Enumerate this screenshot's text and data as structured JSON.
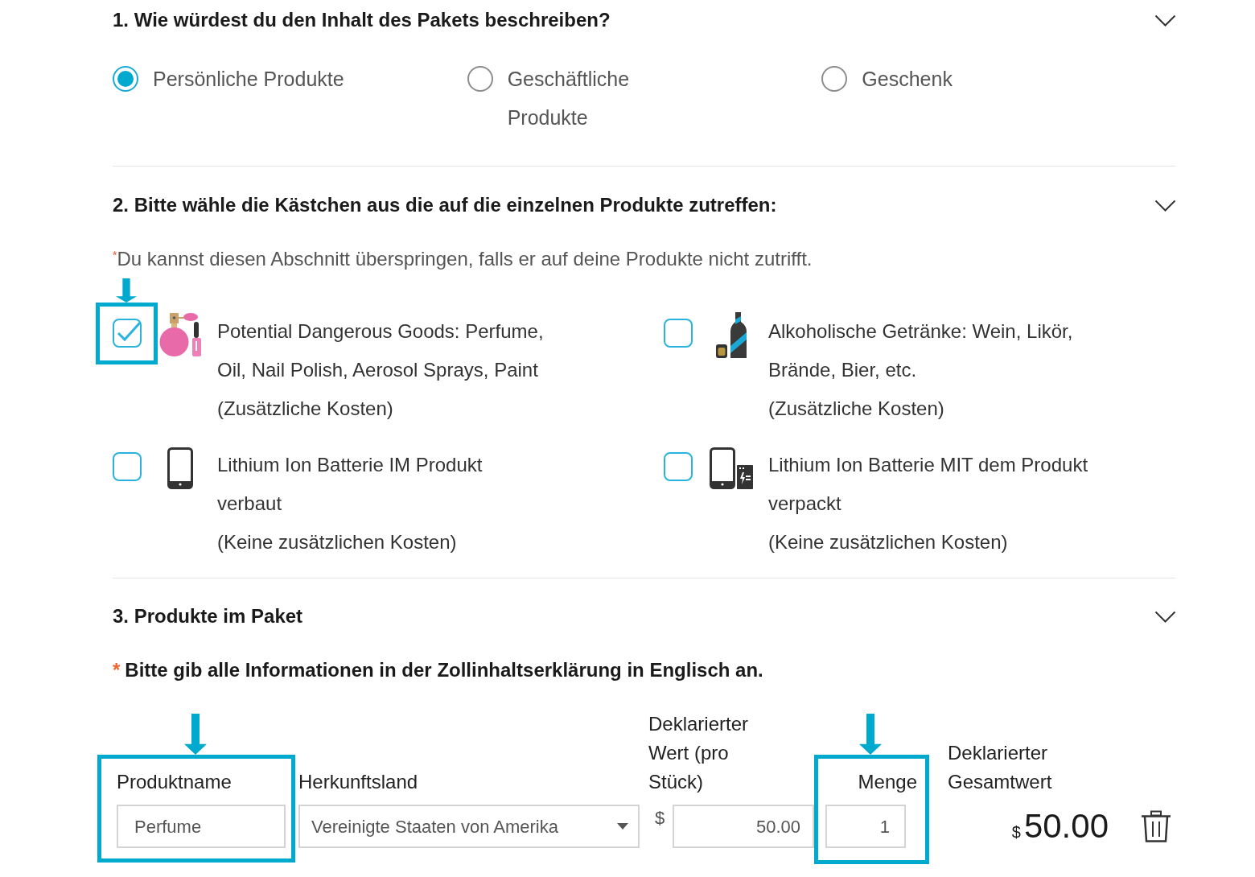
{
  "content_type": {
    "title": "1. Wie würdest du den Inhalt des Pakets beschreiben?",
    "options": [
      {
        "label": "Persönliche Produkte",
        "selected": true
      },
      {
        "label": "Geschäftliche Produkte",
        "selected": false
      },
      {
        "label": "Geschenk",
        "selected": false
      }
    ]
  },
  "product_flags": {
    "title": "2. Bitte wähle die Kästchen aus die auf die einzelnen Produkte zutreffen:",
    "note_mark": "*",
    "note": "Du kannst diesen Abschnitt überspringen, falls er auf deine Produkte nicht zutrifft.",
    "items": [
      {
        "kind": "perfume",
        "label": "Potential Dangerous Goods: Perfume, Oil, Nail Polish, Aerosol Sprays, Paint",
        "cost": "(Zusätzliche Kosten)",
        "checked": true,
        "highlighted": true
      },
      {
        "kind": "alcohol",
        "label": "Alkoholische Getränke: Wein, Likör, Brände, Bier, etc.",
        "cost": "(Zusätzliche Kosten)",
        "checked": false,
        "highlighted": false
      },
      {
        "kind": "battery_in",
        "label": "Lithium Ion Batterie IM Produkt verbaut",
        "cost": "(Keine zusätzlichen Kosten)",
        "checked": false,
        "highlighted": false
      },
      {
        "kind": "battery_with",
        "label": "Lithium Ion Batterie MIT dem Produkt verpackt",
        "cost": "(Keine zusätzlichen Kosten)",
        "checked": false,
        "highlighted": false
      }
    ]
  },
  "products": {
    "title": "3. Produkte im Paket",
    "note_mark": "*",
    "note": "Bitte gib alle Informationen in der Zollinhaltserklärung in Englisch an.",
    "fields": [
      {
        "kind": "text",
        "label": "Produktname",
        "value": "Perfume",
        "highlighted": true
      },
      {
        "kind": "select",
        "label": "Herkunftsland",
        "value": "Vereinigte Staaten von Amerika",
        "highlighted": false
      },
      {
        "kind": "money",
        "label": "Deklarierter Wert (pro Stück)",
        "currency": "$",
        "value": "50.00",
        "highlighted": false
      },
      {
        "kind": "quantity",
        "label": "Menge",
        "value": "1",
        "highlighted": true
      },
      {
        "kind": "total",
        "label": "Deklarierter Gesamtwert",
        "currency": "$",
        "value": "50.00",
        "highlighted": false
      }
    ]
  }
}
